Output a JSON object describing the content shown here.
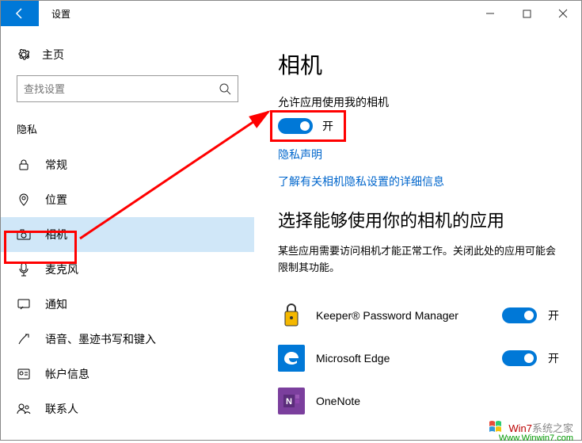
{
  "titlebar": {
    "title": "设置"
  },
  "sidebar": {
    "home": "主页",
    "search_placeholder": "查找设置",
    "section": "隐私",
    "items": [
      {
        "label": "常规"
      },
      {
        "label": "位置"
      },
      {
        "label": "相机"
      },
      {
        "label": "麦克风"
      },
      {
        "label": "通知"
      },
      {
        "label": "语音、墨迹书写和键入"
      },
      {
        "label": "帐户信息"
      },
      {
        "label": "联系人"
      }
    ]
  },
  "content": {
    "heading": "相机",
    "allow_label": "允许应用使用我的相机",
    "toggle_state": "开",
    "privacy_link": "隐私声明",
    "learn_link": "了解有关相机隐私设置的详细信息",
    "choose_heading": "选择能够使用你的相机的应用",
    "choose_desc": "某些应用需要访问相机才能正常工作。关闭此处的应用可能会限制其功能。",
    "apps": [
      {
        "name": "Keeper® Password Manager",
        "state": "开"
      },
      {
        "name": "Microsoft Edge",
        "state": "开"
      },
      {
        "name": "OneNote",
        "state": ""
      }
    ]
  },
  "watermark": {
    "brand": "Win7",
    "text": "系统之家",
    "url": "Www.Winwin7.com"
  }
}
